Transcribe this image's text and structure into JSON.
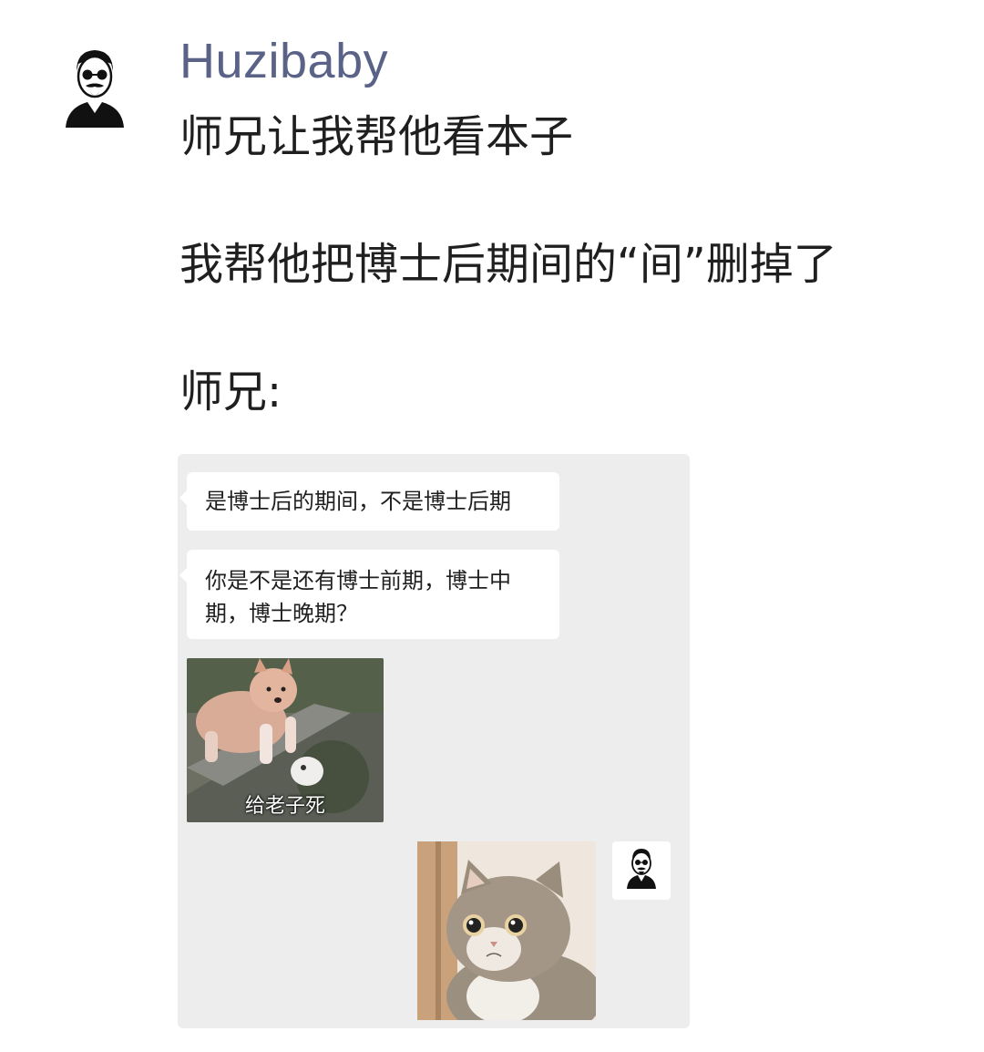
{
  "post": {
    "username": "Huzibaby",
    "line1": "师兄让我帮他看本子",
    "line2": "我帮他把博士后期间的“间”删掉了",
    "line3": "师兄:"
  },
  "chat": {
    "message1": "是博士后的期间，不是博士后期",
    "message2": "你是不是还有博士前期，博士中期，博士晚期？",
    "sticker_caption": "给老子死"
  },
  "icons": {
    "author_avatar": "man-sunglasses-beard-avatar-icon",
    "chat_avatar": "man-sunglasses-beard-avatar-icon"
  }
}
